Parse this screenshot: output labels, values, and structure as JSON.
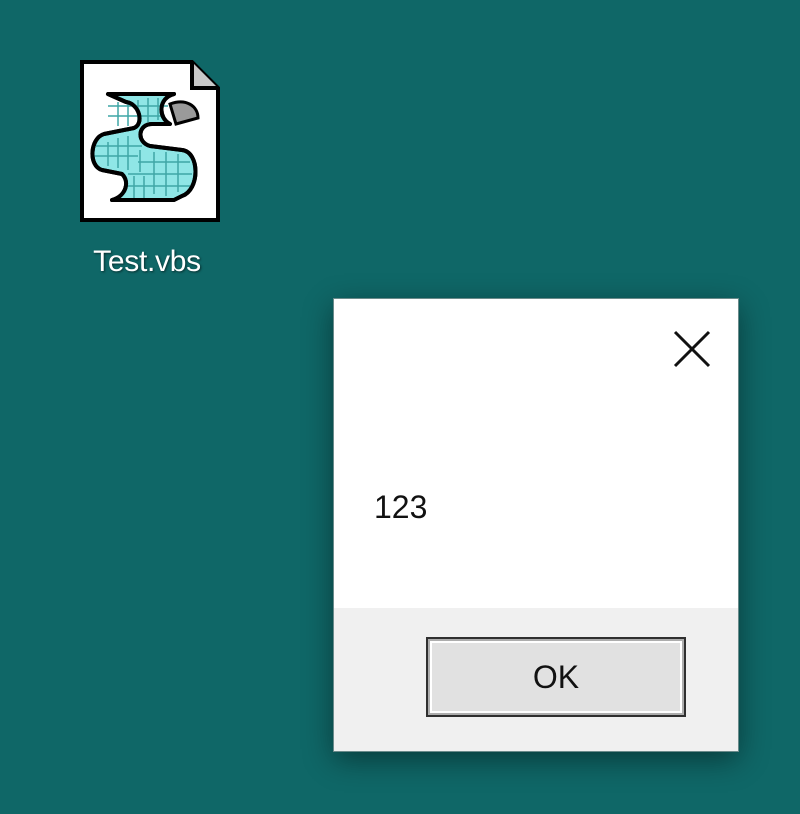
{
  "desktop": {
    "background_color": "#0f6767",
    "icons": [
      {
        "label": "Test.vbs",
        "icon": "vbscript-file-icon"
      }
    ]
  },
  "dialog": {
    "message": "123",
    "ok_label": "OK",
    "close_icon": "close-icon"
  }
}
